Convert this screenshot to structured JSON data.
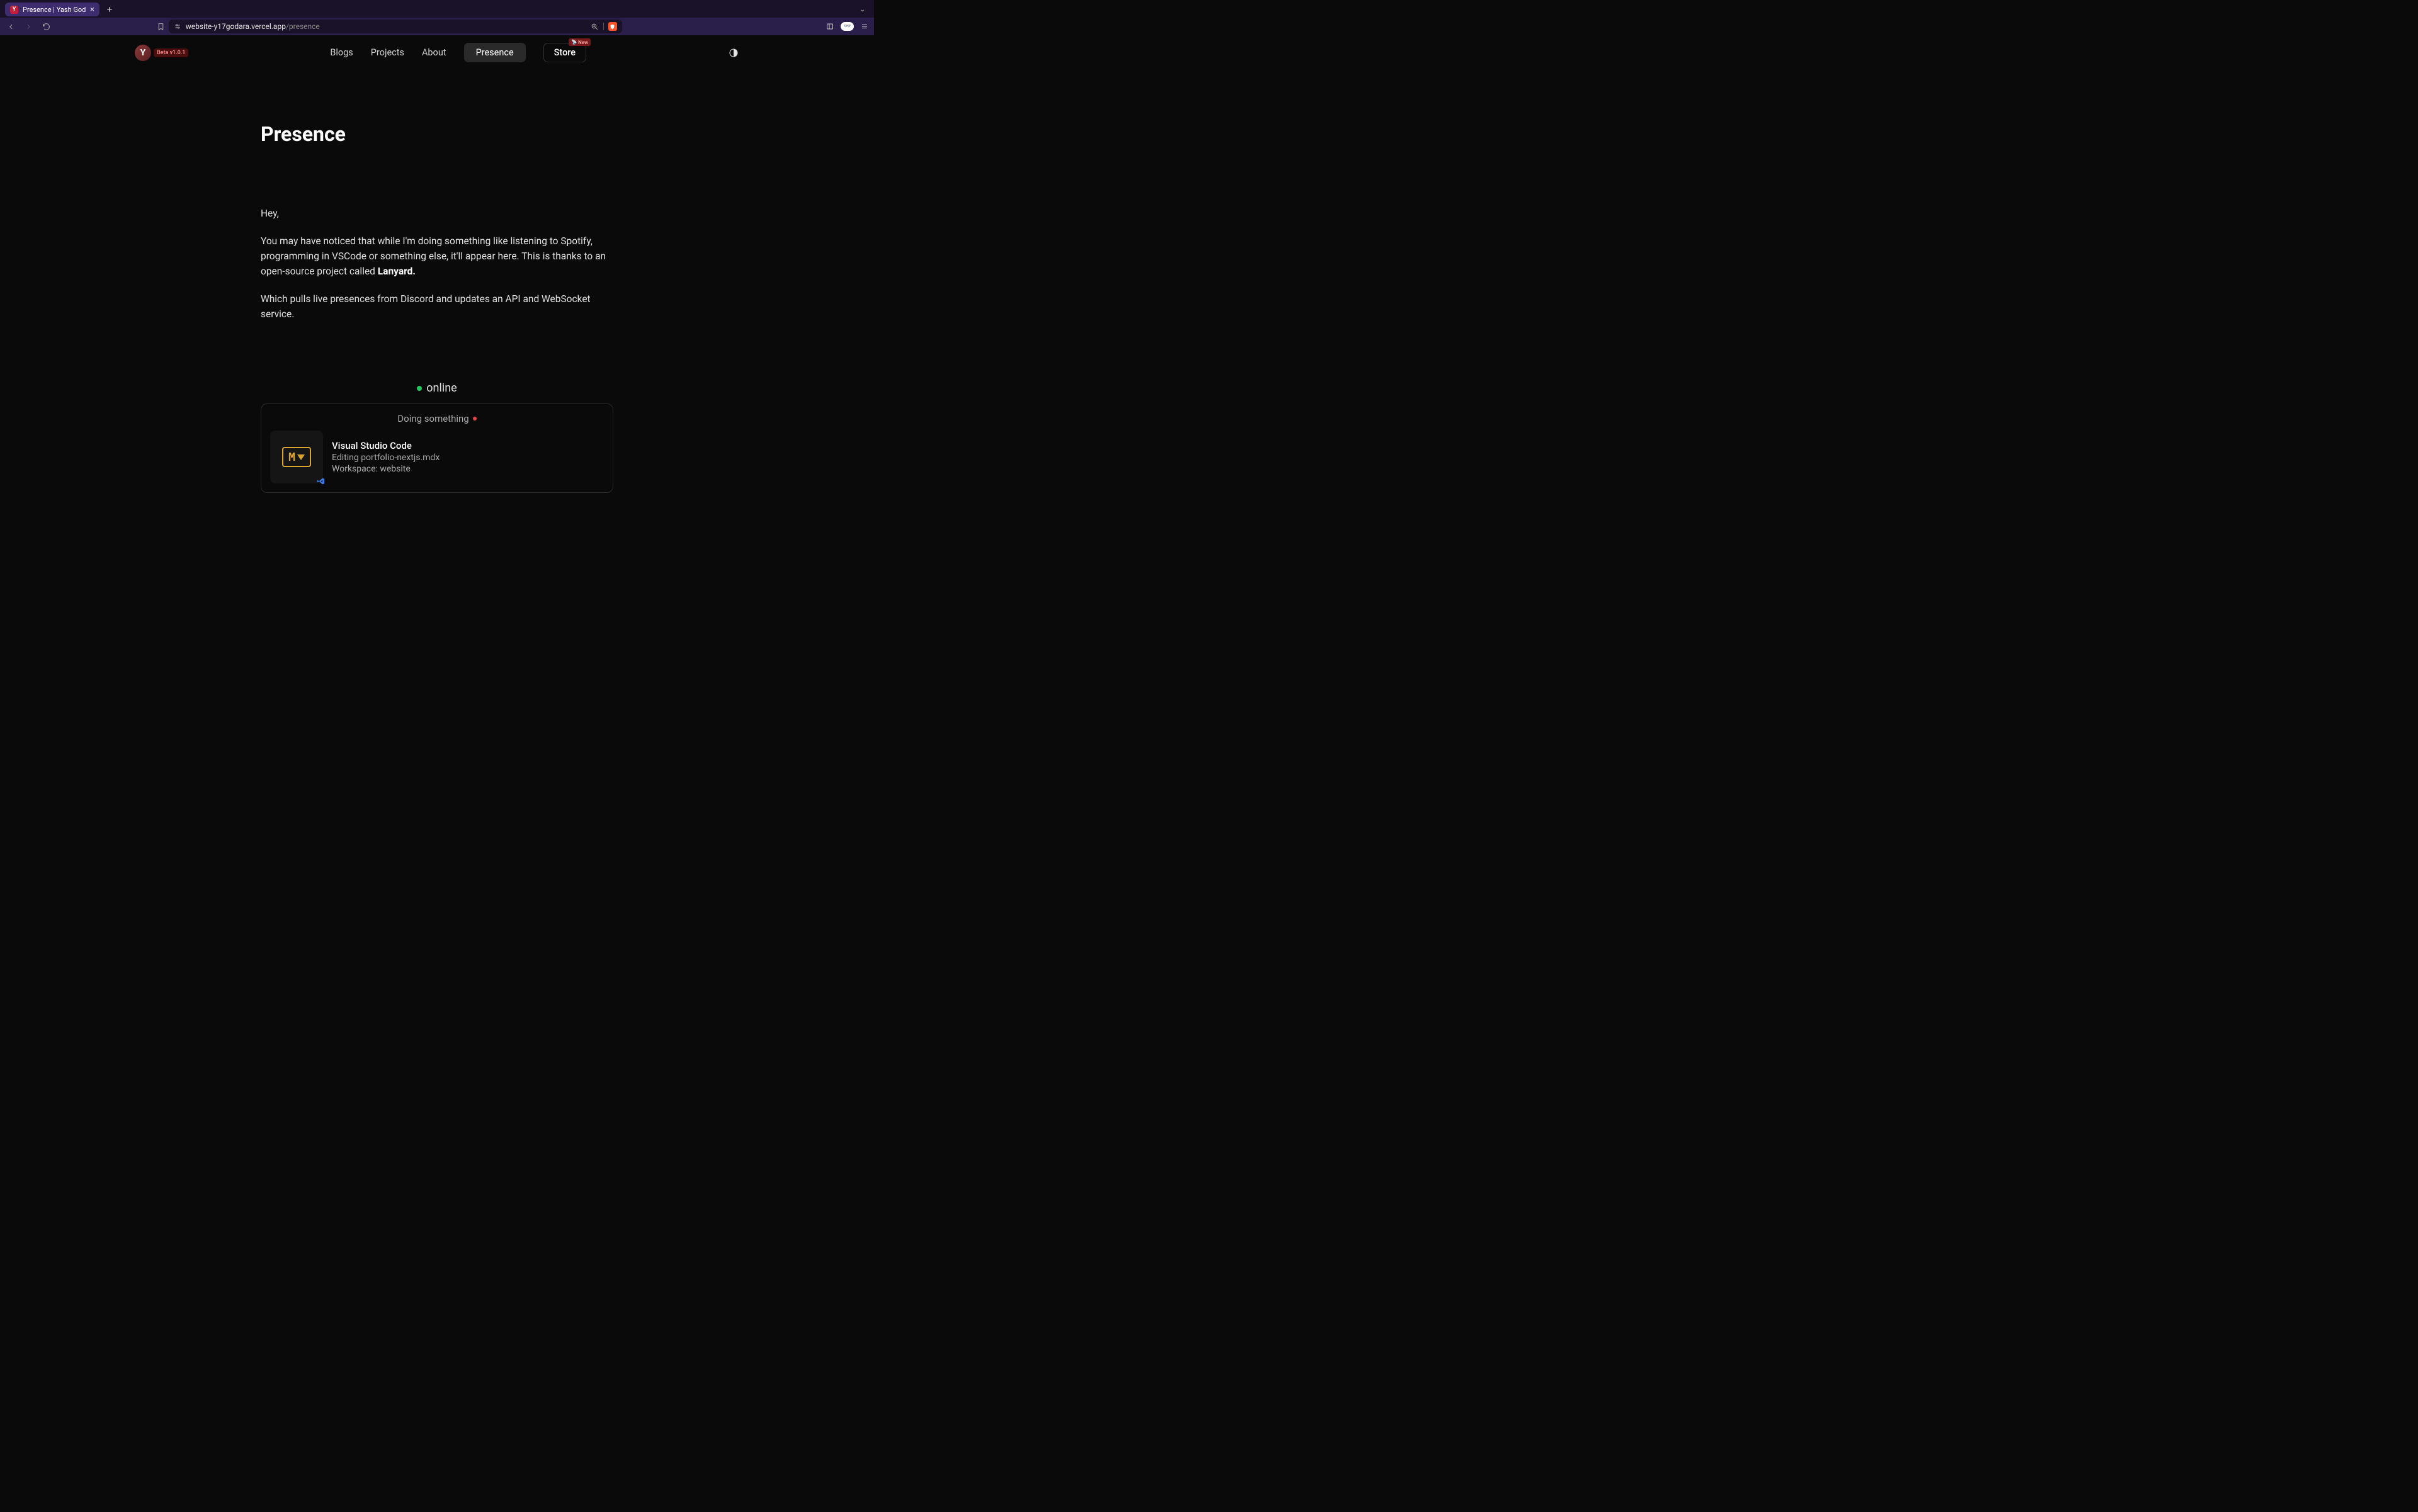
{
  "browser": {
    "tab": {
      "favicon_letter": "Y",
      "title": "Presence | Yash Godara"
    },
    "url": {
      "host": "website-y17godara.vercel.app",
      "path": "/presence"
    }
  },
  "site": {
    "brand_letter": "Y",
    "beta_badge": "Beta v1.0.1",
    "nav": {
      "blogs": "Blogs",
      "projects": "Projects",
      "about": "About",
      "presence": "Presence",
      "store": "Store",
      "new_badge": "New"
    }
  },
  "page": {
    "title": "Presence",
    "hey": "Hey,",
    "p1_a": "You may have noticed that while I'm doing something like listening to Spotify, programming in VSCode or something else, it'll appear here. This is thanks to an open-source project called ",
    "p1_b": "Lanyard.",
    "p2": "Which pulls live presences from Discord and updates an API and WebSocket service."
  },
  "presence": {
    "status_label": "online",
    "card_header": "Doing something",
    "activity": {
      "title": "Visual Studio Code",
      "line1": "Editing portfolio-nextjs.mdx",
      "line2": "Workspace: website"
    }
  }
}
